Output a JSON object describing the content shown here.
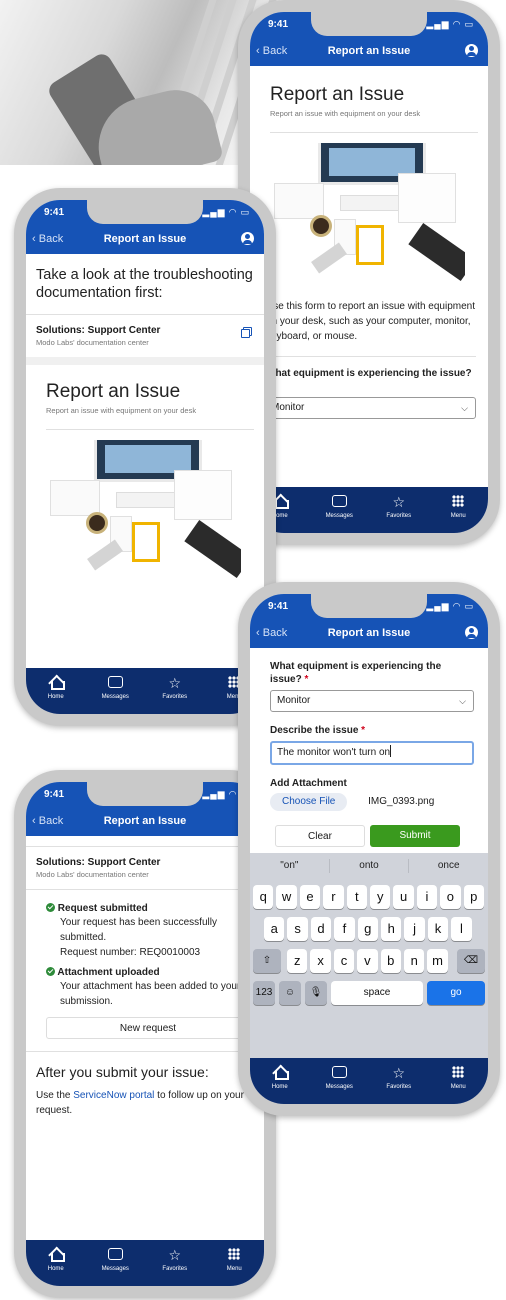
{
  "status_time": "9:41",
  "nav": {
    "back": "Back",
    "title": "Report an Issue"
  },
  "tabs": [
    {
      "label": "Home",
      "icon": "home-icon"
    },
    {
      "label": "Messages",
      "icon": "messages-icon"
    },
    {
      "label": "Favorites",
      "icon": "favorites-icon"
    },
    {
      "label": "Menu",
      "icon": "menu-icon"
    }
  ],
  "colors": {
    "header_blue": "#1653b6",
    "tabbar_navy": "#0d2d6d",
    "submit_green": "#3a9a1e",
    "link_blue": "#1653b6"
  },
  "report": {
    "title": "Report an Issue",
    "subtitle": "Report an issue with equipment on your desk"
  },
  "phone_a": {
    "intro": "Use this form to report an issue with equipment on your desk, such as your computer, monitor, keyboard, or mouse.",
    "question": "What equipment is experiencing the issue?",
    "required_mark": "*",
    "select_value": "Monitor"
  },
  "phone_b": {
    "heading": "Take a look at the troubleshooting documentation first:",
    "solutions_title": "Solutions: Support Center",
    "solutions_sub": "Modo Labs' documentation center"
  },
  "phone_c": {
    "question": "What equipment is experiencing the issue?",
    "required_mark": "*",
    "select_value": "Monitor",
    "describe_label": "Describe the issue",
    "describe_value": "The monitor won't turn on",
    "attachment_label": "Add Attachment",
    "choose_file": "Choose File",
    "file_name": "IMG_0393.png",
    "clear": "Clear",
    "submit": "Submit",
    "keyboard": {
      "suggestions": [
        "\"on\"",
        "onto",
        "once"
      ],
      "row1": [
        "q",
        "w",
        "e",
        "r",
        "t",
        "y",
        "u",
        "i",
        "o",
        "p"
      ],
      "row2": [
        "a",
        "s",
        "d",
        "f",
        "g",
        "h",
        "j",
        "k",
        "l"
      ],
      "row3": [
        "z",
        "x",
        "c",
        "v",
        "b",
        "n",
        "m"
      ],
      "numbers_key": "123",
      "space": "space",
      "go": "go"
    }
  },
  "phone_d": {
    "solutions_title": "Solutions: Support Center",
    "solutions_sub": "Modo Labs' documentation center",
    "submitted_title": "Request submitted",
    "submitted_text": "Your request has been successfully submitted.",
    "request_number": "Request number: REQ0010003",
    "uploaded_title": "Attachment uploaded",
    "uploaded_text": "Your attachment has been added to your submission.",
    "new_request": "New request",
    "after_heading": "After you submit your issue:",
    "after_text_before": "Use the ",
    "after_link": "ServiceNow portal",
    "after_text_after": " to follow up on your request."
  }
}
